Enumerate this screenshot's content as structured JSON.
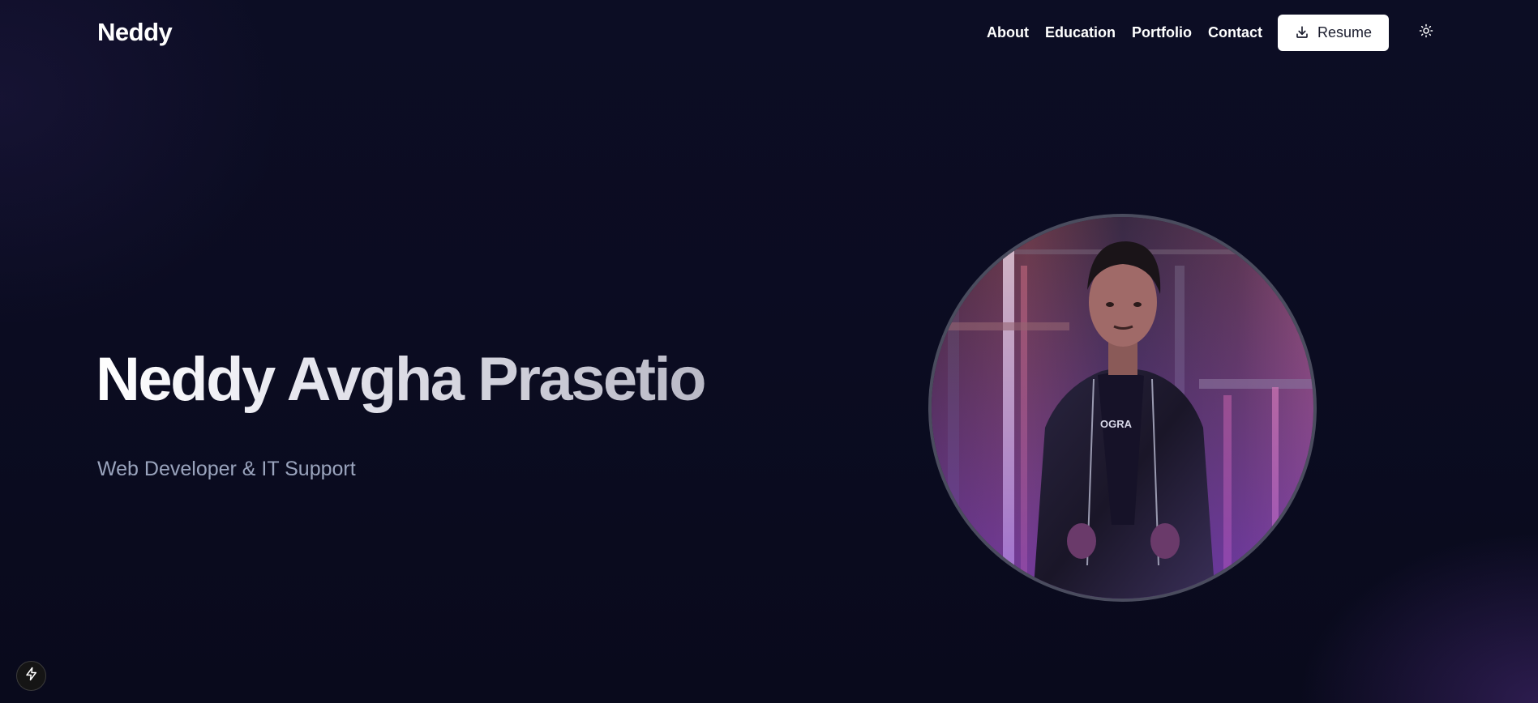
{
  "header": {
    "logo": "Neddy",
    "nav": [
      {
        "label": "About"
      },
      {
        "label": "Education"
      },
      {
        "label": "Portfolio"
      },
      {
        "label": "Contact"
      }
    ],
    "resume_label": "Resume",
    "resume_icon": "download-icon",
    "theme_icon": "sun-icon"
  },
  "hero": {
    "title": "Neddy Avgha Prasetio",
    "subtitle": "Web Developer & IT Support",
    "portrait_icon": "profile-photo"
  },
  "corner": {
    "icon": "lightning-icon"
  },
  "colors": {
    "background": "#0a0b1e",
    "subtitle": "#9aa4bd",
    "button_bg": "#ffffff",
    "portrait_border": "#4a4c5e"
  }
}
